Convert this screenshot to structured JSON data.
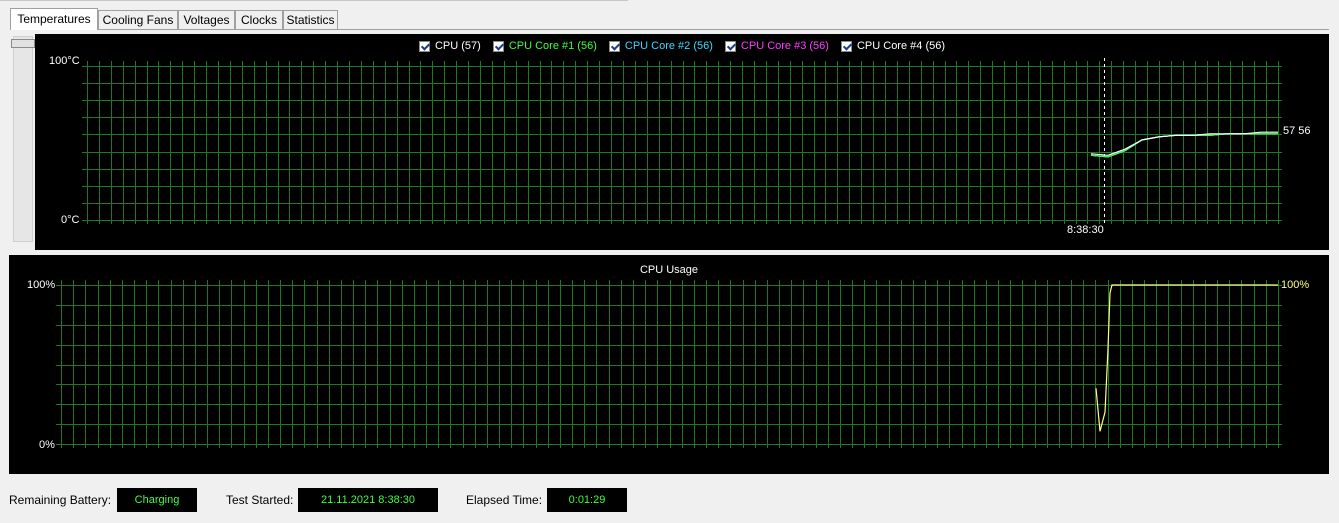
{
  "tabs": [
    {
      "label": "Temperatures",
      "active": true
    },
    {
      "label": "Cooling Fans",
      "active": false
    },
    {
      "label": "Voltages",
      "active": false
    },
    {
      "label": "Clocks",
      "active": false
    },
    {
      "label": "Statistics",
      "active": false
    }
  ],
  "temperature_chart": {
    "legend": [
      {
        "label": "CPU (57)",
        "color": "#ffffff",
        "checked": true
      },
      {
        "label": "CPU Core #1 (56)",
        "color": "#3cff3c",
        "checked": true
      },
      {
        "label": "CPU Core #2 (56)",
        "color": "#3cd8ff",
        "checked": true
      },
      {
        "label": "CPU Core #3 (56)",
        "color": "#ff3cff",
        "checked": true
      },
      {
        "label": "CPU Core #4 (56)",
        "color": "#ffffff",
        "checked": true
      }
    ],
    "y_max_label": "100°C",
    "y_min_label": "0°C",
    "end_value_labels": "57 56",
    "marker_time": "8:38:30"
  },
  "usage_chart": {
    "title": "CPU Usage",
    "y_max_label": "100%",
    "y_min_label": "0%",
    "end_value_label": "100%",
    "line_color": "#ffff80"
  },
  "status_bar": {
    "battery_label": "Remaining Battery:",
    "battery_value": "Charging",
    "test_started_label": "Test Started:",
    "test_started_value": "21.11.2021 8:38:30",
    "elapsed_label": "Elapsed Time:",
    "elapsed_value": "0:01:29"
  },
  "colors": {
    "grid": "#1e7a1e",
    "panel_bg": "#000000",
    "status_value_text": "#3cff3c"
  },
  "chart_data": [
    {
      "type": "line",
      "title": "",
      "ylabel": "°C",
      "ylim": [
        0,
        100
      ],
      "marker_x": "8:38:30",
      "series": [
        {
          "name": "CPU",
          "values": [
            43,
            42,
            46,
            52,
            54,
            55,
            55,
            56,
            56,
            56,
            57,
            57
          ]
        },
        {
          "name": "CPU Core #1",
          "values": [
            42,
            41,
            45,
            52,
            54,
            55,
            55,
            55,
            56,
            56,
            56,
            56
          ]
        },
        {
          "name": "CPU Core #2",
          "values": [
            42,
            41,
            45,
            52,
            54,
            55,
            55,
            55,
            56,
            56,
            56,
            56
          ]
        },
        {
          "name": "CPU Core #3",
          "values": [
            42,
            41,
            45,
            52,
            54,
            55,
            55,
            55,
            56,
            56,
            56,
            56
          ]
        },
        {
          "name": "CPU Core #4",
          "values": [
            42,
            41,
            45,
            52,
            54,
            55,
            55,
            55,
            56,
            56,
            56,
            56
          ]
        }
      ]
    },
    {
      "type": "line",
      "title": "CPU Usage",
      "ylim": [
        0,
        100
      ],
      "series": [
        {
          "name": "CPU Usage",
          "values": [
            35,
            8,
            20,
            60,
            95,
            100,
            100,
            100,
            100,
            100,
            100,
            100
          ]
        }
      ]
    }
  ]
}
